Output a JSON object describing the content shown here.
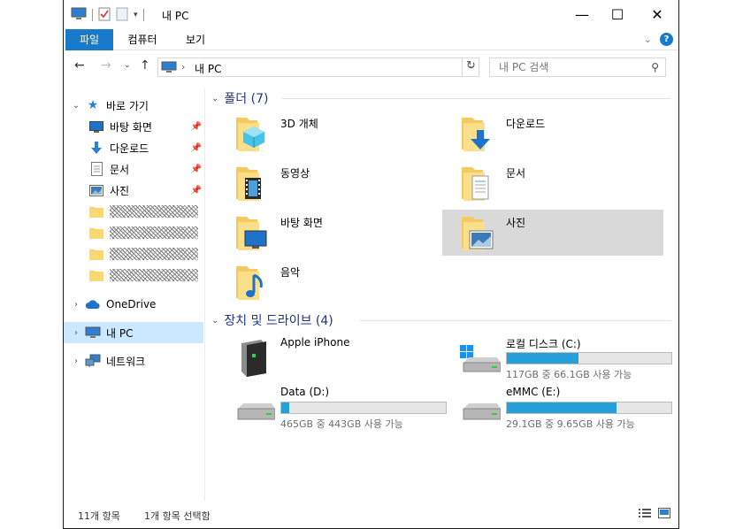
{
  "window": {
    "title": "내 PC",
    "minimize": "—",
    "maximize": "☐",
    "close": "✕"
  },
  "ribbon": {
    "tabs": [
      {
        "label": "파일"
      },
      {
        "label": "컴퓨터"
      },
      {
        "label": "보기"
      }
    ],
    "help": "?"
  },
  "address": {
    "path": "내 PC",
    "search_placeholder": "내 PC 검색"
  },
  "sidebar": {
    "quick_access": "바로 가기",
    "pinned": [
      {
        "label": "바탕 화면",
        "icon": "desktop-icon"
      },
      {
        "label": "다운로드",
        "icon": "download-icon"
      },
      {
        "label": "문서",
        "icon": "document-icon"
      },
      {
        "label": "사진",
        "icon": "pictures-icon"
      }
    ],
    "onedrive": "OneDrive",
    "this_pc": "내 PC",
    "network": "네트워크"
  },
  "folders": {
    "header": "폴더 (7)",
    "items": [
      {
        "label": "3D 개체",
        "icon": "3d-objects-icon"
      },
      {
        "label": "다운로드",
        "icon": "downloads-folder-icon"
      },
      {
        "label": "동영상",
        "icon": "videos-folder-icon"
      },
      {
        "label": "문서",
        "icon": "documents-folder-icon"
      },
      {
        "label": "바탕 화면",
        "icon": "desktop-folder-icon"
      },
      {
        "label": "사진",
        "icon": "pictures-folder-icon"
      },
      {
        "label": "음악",
        "icon": "music-folder-icon"
      }
    ]
  },
  "devices": {
    "header": "장치 및 드라이브 (4)",
    "items": [
      {
        "label": "Apple iPhone",
        "icon": "phone-device-icon"
      },
      {
        "label": "로컬 디스크 (C:)",
        "info": "117GB 중 66.1GB 사용 가능",
        "used_fraction": 0.435,
        "icon": "system-drive-icon"
      },
      {
        "label": "Data (D:)",
        "info": "465GB 중 443GB 사용 가능",
        "used_fraction": 0.047,
        "icon": "hard-drive-icon"
      },
      {
        "label": "eMMC (E:)",
        "info": "29.1GB 중 9.65GB 사용 가능",
        "used_fraction": 0.668,
        "icon": "hard-drive-icon"
      }
    ]
  },
  "status": {
    "count": "11개 항목",
    "selected": "1개 항목 선택함"
  },
  "colors": {
    "accent": "#1979ca",
    "selection": "#cce8ff",
    "drive_bar": "#26a0da"
  }
}
